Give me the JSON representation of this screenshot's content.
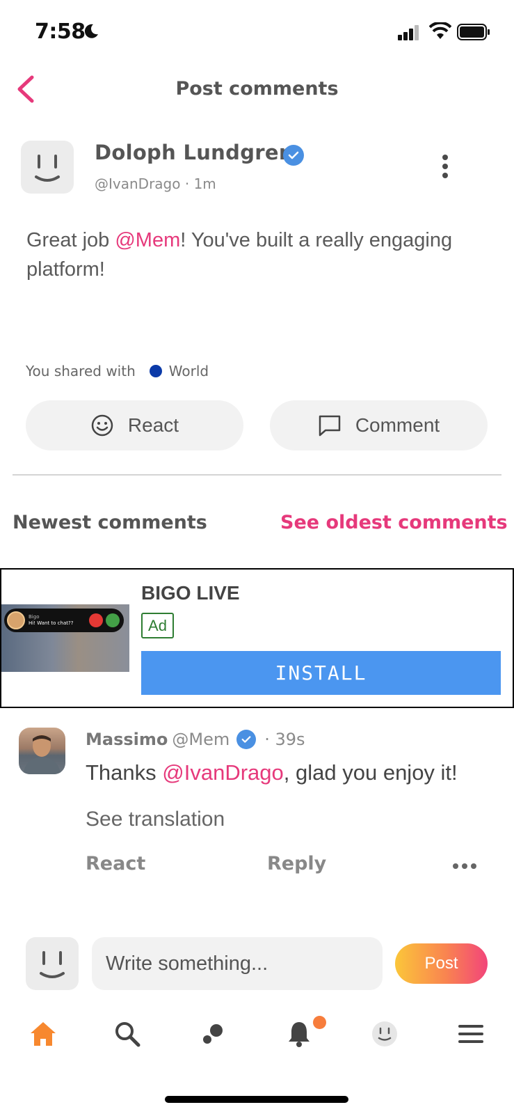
{
  "status_bar": {
    "time": "7:58"
  },
  "header": {
    "title": "Post comments"
  },
  "post": {
    "author_name": "Doloph Lundgren",
    "handle": "@IvanDrago",
    "time_ago": "1m",
    "body_prefix": "Great job ",
    "body_mention": "@Mem",
    "body_suffix": "! You've built a really engaging platform!",
    "shared_label": "You shared with",
    "shared_audience": "World",
    "react_label": "React",
    "comment_label": "Comment"
  },
  "comments_header": {
    "newest_label": "Newest comments",
    "oldest_link": "See oldest comments"
  },
  "ad": {
    "advertiser": "BIGO LIVE",
    "badge": "Ad",
    "cta": "INSTALL",
    "thumb_caller": "Bigo",
    "thumb_message": "Hi! Want to chat??"
  },
  "comment": {
    "author_name": "Massimo",
    "handle": "@Mem",
    "time_ago": "· 39s",
    "text_prefix": "Thanks ",
    "text_mention": "@IvanDrago",
    "text_suffix": ", glad you enjoy it!",
    "translate_label": "See translation",
    "react_label": "React",
    "reply_label": "Reply"
  },
  "composer": {
    "placeholder": "Write something...",
    "post_label": "Post"
  },
  "tab_bar": {
    "items": [
      "home-icon",
      "search-icon",
      "discover-icon",
      "bell-icon",
      "profile-icon",
      "menu-icon"
    ],
    "active": "home-icon"
  },
  "colors": {
    "accent_pink": "#e6397b",
    "home_orange": "#f7882f",
    "verified_blue": "#4a90e2",
    "install_blue": "#4b96f0",
    "ad_badge_green": "#2e7d32",
    "world_dot": "#0b3aa8"
  }
}
